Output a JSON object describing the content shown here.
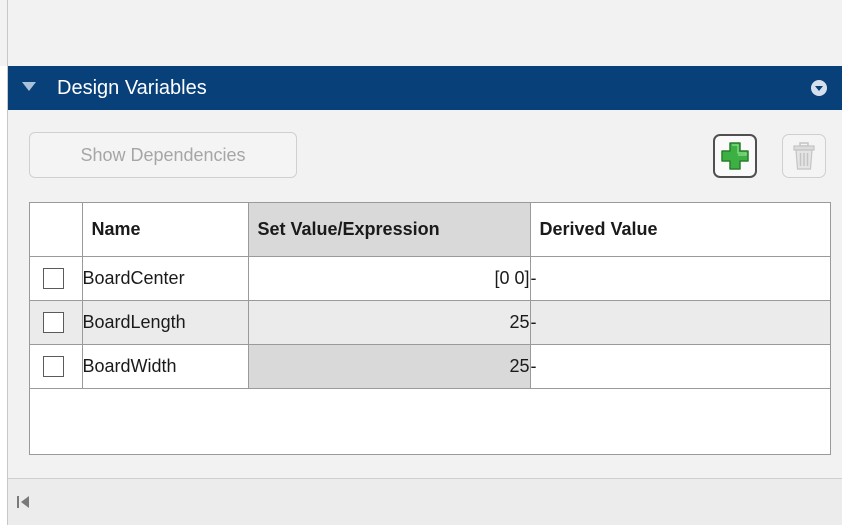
{
  "panel": {
    "title": "Design Variables"
  },
  "toolbar": {
    "show_dependencies_label": "Show Dependencies",
    "add_icon": "plus-icon",
    "delete_icon": "trash-icon"
  },
  "table": {
    "columns": [
      "",
      "Name",
      "Set Value/Expression",
      "Derived Value"
    ],
    "rows": [
      {
        "checked": false,
        "name": "BoardCenter",
        "expression": "[0 0]",
        "derived": "-"
      },
      {
        "checked": false,
        "name": "BoardLength",
        "expression": "25",
        "derived": "-"
      },
      {
        "checked": false,
        "name": "BoardWidth",
        "expression": "25",
        "derived": "-"
      }
    ]
  },
  "colors": {
    "header_bg": "#08407a",
    "selected_cell_bg": "#d9d9d9",
    "add_icon_green": "#3cb043"
  }
}
